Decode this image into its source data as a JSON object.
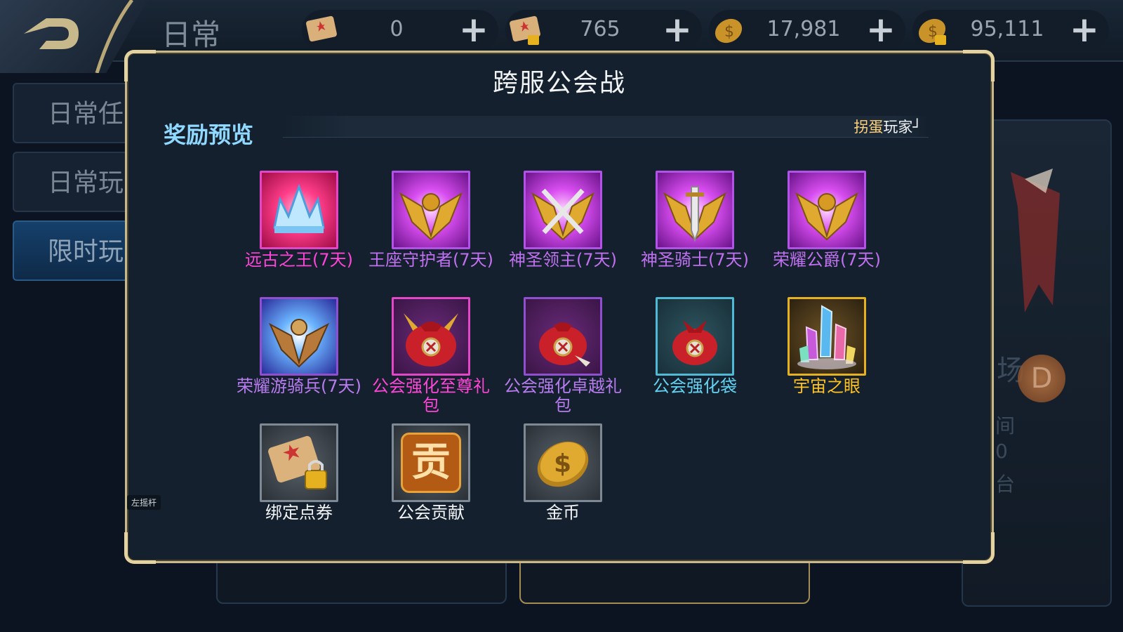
{
  "header": {
    "title": "日常",
    "resources": [
      {
        "icon": "scroll-icon",
        "value": "0",
        "plus": "+"
      },
      {
        "icon": "locked-scroll-icon",
        "value": "765",
        "plus": "+"
      },
      {
        "icon": "gold-coin-icon",
        "value": "17,981",
        "plus": "+"
      },
      {
        "icon": "locked-coin-icon",
        "value": "95,111",
        "plus": "+"
      }
    ]
  },
  "sidebar": {
    "tabs": [
      {
        "label": "日常任"
      },
      {
        "label": "日常玩"
      },
      {
        "label": "限时玩"
      }
    ]
  },
  "background_right": {
    "line1": "场",
    "line2": "间",
    "line3": "0",
    "line4": "台",
    "badge": "D"
  },
  "modal": {
    "title": "跨服公会战",
    "section_label": "奖励预览",
    "marquee_highlight": "拐蛋",
    "marquee_rest": "玩家┘",
    "joystick_label": "左摇杆"
  },
  "rewards": [
    {
      "name": "远古之王(7天)",
      "quality": "magenta",
      "icon": "ice-crown-icon"
    },
    {
      "name": "王座守护者(7天)",
      "quality": "purple",
      "icon": "winged-helm-icon"
    },
    {
      "name": "神圣领主(7天)",
      "quality": "purple",
      "icon": "crossed-swords-badge-icon"
    },
    {
      "name": "神圣骑士(7天)",
      "quality": "purple",
      "icon": "winged-sword-badge-icon"
    },
    {
      "name": "荣耀公爵(7天)",
      "quality": "purple",
      "icon": "winged-helm-icon"
    },
    {
      "name": "荣耀游骑兵(7天)",
      "quality": "violet",
      "icon": "winged-orb-badge-icon"
    },
    {
      "name": "公会强化至尊礼包",
      "quality": "magenta",
      "icon": "winged-gift-bag-icon"
    },
    {
      "name": "公会强化卓越礼包",
      "quality": "violet",
      "icon": "gift-bag-icon"
    },
    {
      "name": "公会强化袋",
      "quality": "blue",
      "icon": "red-bag-icon"
    },
    {
      "name": "宇宙之眼",
      "quality": "gold",
      "icon": "crystal-cluster-icon"
    },
    {
      "name": "绑定点券",
      "quality": "gray",
      "icon": "locked-scroll-icon"
    },
    {
      "name": "公会贡献",
      "quality": "gray",
      "icon": "contribution-icon",
      "glyph": "贡"
    },
    {
      "name": "金币",
      "quality": "gray",
      "icon": "gold-coin-icon"
    }
  ]
}
